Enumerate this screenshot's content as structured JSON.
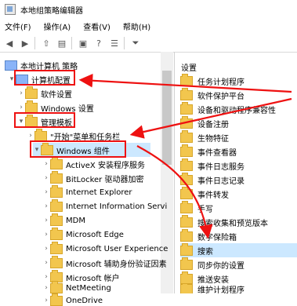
{
  "window": {
    "title": "本地组策略编辑器"
  },
  "menu": {
    "items": [
      "文件(F)",
      "操作(A)",
      "查看(V)",
      "帮助(H)"
    ]
  },
  "left_tree": {
    "root": "本地计算机 策略",
    "computer_config": "计算机配置",
    "software_settings": "软件设置",
    "windows_settings": "Windows 设置",
    "admin_templates": "管理模板",
    "start_menu_taskbar": "\"开始\"菜单和任务栏",
    "windows_components": "Windows 组件",
    "children": [
      "ActiveX 安装程序服务",
      "BitLocker 驱动器加密",
      "Internet Explorer",
      "Internet Information Servi",
      "MDM",
      "Microsoft Edge",
      "Microsoft User Experience",
      "Microsoft 辅助身份验证因素",
      "Microsoft 帐户",
      "NetMeeting",
      "OneDrive"
    ]
  },
  "right_pane": {
    "header": "设置",
    "items": [
      "任务计划程序",
      "软件保护平台",
      "设备和驱动程序兼容性",
      "设备注册",
      "生物特征",
      "事件查看器",
      "事件日志服务",
      "事件日志记录",
      "事件转发",
      "手写",
      "搜索收集和预览版本",
      "数字保险箱",
      "搜索",
      "同步你的设置",
      "推送安装",
      "维护计划程序"
    ],
    "selected_item": "搜索"
  }
}
